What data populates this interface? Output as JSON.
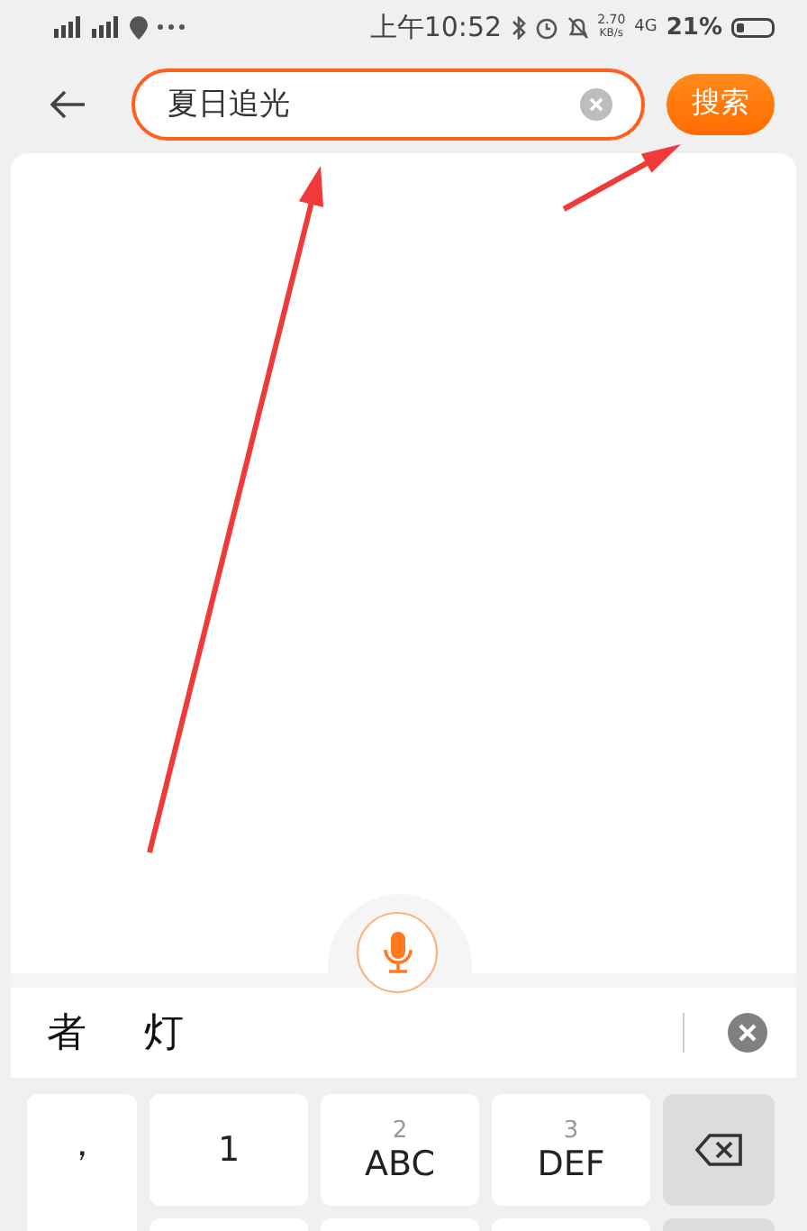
{
  "status_bar": {
    "time": "上午10:52",
    "speed_value": "2.70",
    "speed_unit": "KB/s",
    "network": "4G",
    "battery": "21%"
  },
  "search": {
    "value": "夏日追光",
    "button": "搜索"
  },
  "candidates": [
    "者",
    "灯"
  ],
  "keyboard": {
    "side_key": "，",
    "keys": [
      {
        "kind": "char",
        "label": "1"
      },
      {
        "kind": "char",
        "number": "2",
        "label": "ABC"
      },
      {
        "kind": "char",
        "number": "3",
        "label": "DEF"
      },
      {
        "kind": "backspace"
      }
    ]
  }
}
